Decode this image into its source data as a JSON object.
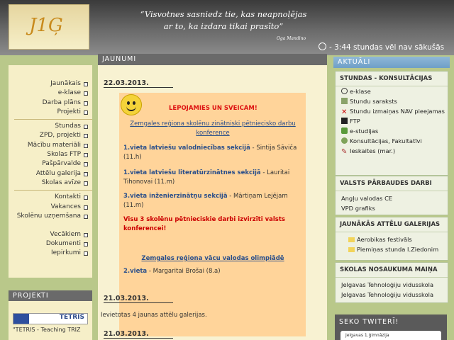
{
  "header": {
    "logo_text": "J1Ģ",
    "quote_line1": "“Visvotnes sasniedz tie, kas neapnoļējas",
    "quote_line2": "ar to, ka izdara tikai prasīto”",
    "quote_author": "Oga Mandino",
    "clock_text": "- 3:44   stundas vēl nav sākušās"
  },
  "nav": {
    "group1": [
      "Jaunākais",
      "e-klase",
      "Darba plāns",
      "Projekti"
    ],
    "group2": [
      "Stundas",
      "ZPD, projekti",
      "Mācību materiāli",
      "Skolas FTP",
      "Pašpārvalde",
      "Attēlu galerija",
      "Skolas avīze"
    ],
    "group3": [
      "Kontakti",
      "Vakances",
      "Skolēnu uzņemšana",
      "Vecākiem",
      "Dokumenti",
      "Iepirkumi"
    ]
  },
  "projekti": {
    "heading": "PROJEKTI",
    "logo_text": "TETRIS",
    "caption": "\"TETRIS - Teaching TRIZ"
  },
  "main": {
    "heading": "JAUNUMI",
    "date1": "22.03.2013.",
    "banner_title": "LEPOJAMIES UN SVEICAM!",
    "conf_title": "Zemgales reģiona skolēnu zinātniski pētniecisko darbu konference",
    "r1_link": "1.vieta latviešu valodniecības sekcijā",
    "r1_rest": " - Sintija Sāviča (11.h)",
    "r2_link": "1.vieta latviešu literatūrzinātnes sekcijā",
    "r2_rest": " - Lauritai Tihonovai (11.m)",
    "r3_link": "3.vieta inženierzinātņu sekcijā",
    "r3_rest": " - Mārtiņam Lejējam (11.m)",
    "note": "Visu 3 skolēnu pētnieciskie darbi izvirzīti valsts konferencei!",
    "olympiad_title": "Zemgales reģiona vācu valodas olimpiādē",
    "o1_link": "2.vieta",
    "o1_rest": " - Margaritai Brošai (8.a)",
    "date2": "21.03.2013.",
    "gallery_text": "Ievietotas 4 jaunas attēlu galerijas.",
    "date3": "21.03.2013."
  },
  "right": {
    "heading": "AKTUĀLI",
    "box1_title": "STUNDAS - KONSULTĀCIJAS",
    "box1_items": [
      "e-klase",
      "Stundu saraksts",
      "Stundu izmaiņas NAV pieejamas",
      "FTP",
      "e-studijas",
      "Konsultācijas, Fakultatīvi",
      "Ieskaites (mar.)"
    ],
    "box2_title": "VALSTS PĀRBAUDES DARBI",
    "box2_items": [
      "Angļu valodas CE",
      "VPD grafiks"
    ],
    "box3_title": "JAUNĀKĀS ATTĒLU GALERIJAS",
    "box3_items": [
      "Aerobikas festivāls",
      "Piemiņas stunda I.Ziedonim"
    ],
    "box4_title": "SKOLAS NOSAUKUMA MAIŅA",
    "box4_items": [
      "Jelgavas Tehnoloģiju vidusskola",
      "Jelgavas Tehnoloģiju vidusskola"
    ],
    "seko_title": "SEKO TWITERĪ!",
    "seko_widget_text": "Jelgavas 1.ģimnāzija"
  },
  "colors": {
    "header_dark": "#3a3a3a",
    "page_green": "#b9c88a",
    "cream": "#f6efc8",
    "orange_box": "#ffd49a",
    "link_blue": "#2b4f8a",
    "red": "#cc0000"
  }
}
